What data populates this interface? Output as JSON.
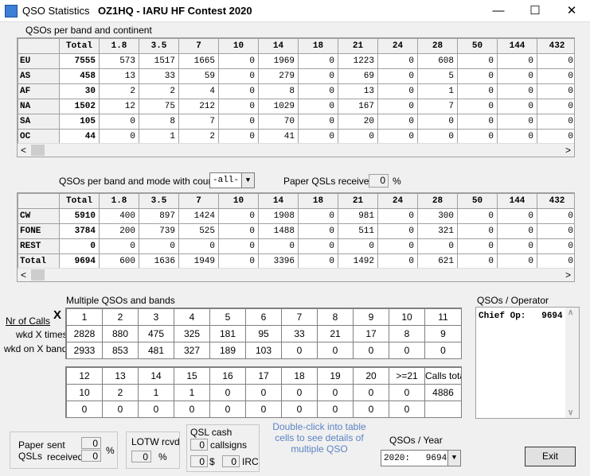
{
  "window": {
    "title_left": "QSO Statistics",
    "title_main": "OZ1HQ  -  IARU HF Contest 2020"
  },
  "section1": {
    "title": "QSOs per band and continent",
    "headers": [
      "Total",
      "1.8",
      "3.5",
      "7",
      "10",
      "14",
      "18",
      "21",
      "24",
      "28",
      "50",
      "144",
      "432"
    ],
    "rows": [
      {
        "label": "EU",
        "values": [
          "7555",
          "573",
          "1517",
          "1665",
          "0",
          "1969",
          "0",
          "1223",
          "0",
          "608",
          "0",
          "0",
          "0"
        ]
      },
      {
        "label": "AS",
        "values": [
          "458",
          "13",
          "33",
          "59",
          "0",
          "279",
          "0",
          "69",
          "0",
          "5",
          "0",
          "0",
          "0"
        ]
      },
      {
        "label": "AF",
        "values": [
          "30",
          "2",
          "2",
          "4",
          "0",
          "8",
          "0",
          "13",
          "0",
          "1",
          "0",
          "0",
          "0"
        ]
      },
      {
        "label": "NA",
        "values": [
          "1502",
          "12",
          "75",
          "212",
          "0",
          "1029",
          "0",
          "167",
          "0",
          "7",
          "0",
          "0",
          "0"
        ]
      },
      {
        "label": "SA",
        "values": [
          "105",
          "0",
          "8",
          "7",
          "0",
          "70",
          "0",
          "20",
          "0",
          "0",
          "0",
          "0",
          "0"
        ]
      },
      {
        "label": "OC",
        "values": [
          "44",
          "0",
          "1",
          "2",
          "0",
          "41",
          "0",
          "0",
          "0",
          "0",
          "0",
          "0",
          "0"
        ]
      }
    ]
  },
  "section2": {
    "title": "QSOs per band and mode with country",
    "country_value": "-all-",
    "paper_label": "Paper QSLs received",
    "paper_pct": "0",
    "pct": "%",
    "headers": [
      "Total",
      "1.8",
      "3.5",
      "7",
      "10",
      "14",
      "18",
      "21",
      "24",
      "28",
      "50",
      "144",
      "432"
    ],
    "rows": [
      {
        "label": "CW",
        "values": [
          "5910",
          "400",
          "897",
          "1424",
          "0",
          "1908",
          "0",
          "981",
          "0",
          "300",
          "0",
          "0",
          "0"
        ]
      },
      {
        "label": "FONE",
        "values": [
          "3784",
          "200",
          "739",
          "525",
          "0",
          "1488",
          "0",
          "511",
          "0",
          "321",
          "0",
          "0",
          "0"
        ]
      },
      {
        "label": "REST",
        "values": [
          "0",
          "0",
          "0",
          "0",
          "0",
          "0",
          "0",
          "0",
          "0",
          "0",
          "0",
          "0",
          "0"
        ]
      },
      {
        "label": "Total",
        "values": [
          "9694",
          "600",
          "1636",
          "1949",
          "0",
          "3396",
          "0",
          "1492",
          "0",
          "621",
          "0",
          "0",
          "0"
        ]
      }
    ]
  },
  "multiple": {
    "title": "Multiple QSOs and bands",
    "nr_calls": "Nr of Calls",
    "x_label": "X",
    "row1_label": "wkd X times",
    "row2_label": "wkd on X bands",
    "headers1": [
      "1",
      "2",
      "3",
      "4",
      "5",
      "6",
      "7",
      "8",
      "9",
      "10",
      "11"
    ],
    "row1a": [
      "2828",
      "880",
      "475",
      "325",
      "181",
      "95",
      "33",
      "21",
      "17",
      "8",
      "9"
    ],
    "row2a": [
      "2933",
      "853",
      "481",
      "327",
      "189",
      "103",
      "0",
      "0",
      "0",
      "0",
      "0"
    ],
    "headers2": [
      "12",
      "13",
      "14",
      "15",
      "16",
      "17",
      "18",
      "19",
      "20",
      ">=21",
      "Calls total"
    ],
    "row1b": [
      "10",
      "2",
      "1",
      "1",
      "0",
      "0",
      "0",
      "0",
      "0",
      "0",
      "4886"
    ],
    "row2b": [
      "0",
      "0",
      "0",
      "0",
      "0",
      "0",
      "0",
      "0",
      "0",
      "0",
      ""
    ]
  },
  "operator": {
    "title": "QSOs / Operator",
    "text": "Chief Op:   9694"
  },
  "paper_qsls": {
    "label1": "Paper",
    "label2": "QSLs",
    "sent_label": "sent",
    "received_label": "received",
    "sent": "0",
    "received": "0",
    "pct": "%"
  },
  "lotw": {
    "label": "LOTW rcvd",
    "value": "0",
    "pct": "%"
  },
  "qsl_cash": {
    "label": "QSL cash",
    "callsigns_value": "0",
    "callsigns_label": "callsigns",
    "dollar_value": "0",
    "dollar_label": "$",
    "irc_value": "0",
    "irc_label": "IRC"
  },
  "hint": {
    "line1": "Double-click into table",
    "line2": "cells to see details of",
    "line3": "multiple QSO"
  },
  "year": {
    "label": "QSOs / Year",
    "value": "2020:   9694"
  },
  "exit_label": "Exit",
  "colors": {
    "hint": "#5b84c4",
    "accent": "#3c7fd6"
  }
}
